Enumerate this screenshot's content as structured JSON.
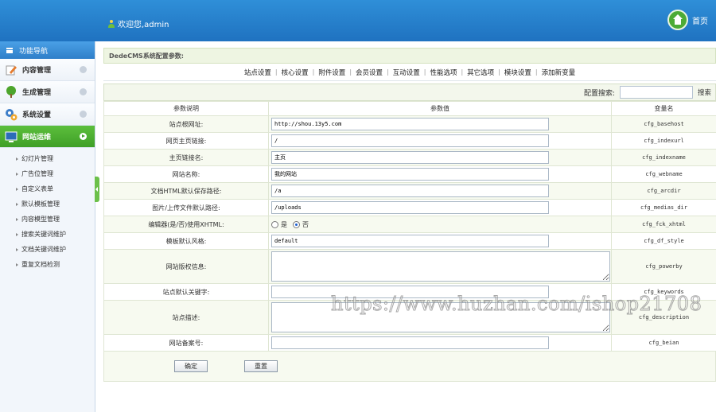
{
  "header": {
    "welcome": "欢迎您,admin",
    "home_label": "首页",
    "accent": "#2f8fd8"
  },
  "sidebar": {
    "title": "功能导航",
    "items": [
      {
        "label": "内容管理",
        "icon": "pencil-icon"
      },
      {
        "label": "生成管理",
        "icon": "tree-icon"
      },
      {
        "label": "系统设置",
        "icon": "gears-icon"
      },
      {
        "label": "网站运维",
        "icon": "monitor-icon",
        "active": true
      }
    ],
    "sub_items": [
      "幻灯片管理",
      "广告位管理",
      "自定义表单",
      "默认模板管理",
      "内容模型管理",
      "搜索关键词维护",
      "文档关键词维护",
      "重复文档检测"
    ]
  },
  "main": {
    "section_title": "DedeCMS系统配置参数:",
    "tabs": [
      "站点设置",
      "核心设置",
      "附件设置",
      "会员设置",
      "互动设置",
      "性能选项",
      "其它选项",
      "模块设置",
      "添加新变量"
    ],
    "search_label": "配置搜索:",
    "search_value": "",
    "search_button": "搜索",
    "table": {
      "headers": [
        "参数说明",
        "参数值",
        "变量名"
      ],
      "rows": [
        {
          "label": "站点根网址:",
          "type": "text",
          "value": "http://shou.13y5.com",
          "var": "cfg_basehost"
        },
        {
          "label": "网页主页链接:",
          "type": "text",
          "value": "/",
          "var": "cfg_indexurl"
        },
        {
          "label": "主页链接名:",
          "type": "text",
          "value": "主页",
          "var": "cfg_indexname"
        },
        {
          "label": "网站名称:",
          "type": "text",
          "value": "我的网站",
          "var": "cfg_webname"
        },
        {
          "label": "文档HTML默认保存路径:",
          "type": "text",
          "value": "/a",
          "var": "cfg_arcdir"
        },
        {
          "label": "图片/上传文件默认路径:",
          "type": "text",
          "value": "/uploads",
          "var": "cfg_medias_dir"
        },
        {
          "label": "编辑器(是/否)使用XHTML:",
          "type": "radio",
          "opt_yes": "是",
          "opt_no": "否",
          "var": "cfg_fck_xhtml"
        },
        {
          "label": "模板默认风格:",
          "type": "text",
          "value": "default",
          "var": "cfg_df_style"
        },
        {
          "label": "网站版权信息:",
          "type": "textarea",
          "value": "",
          "var": "cfg_powerby"
        },
        {
          "label": "站点默认关键字:",
          "type": "text",
          "value": "",
          "var": "cfg_keywords"
        },
        {
          "label": "站点描述:",
          "type": "textarea",
          "value": "",
          "var": "cfg_description"
        },
        {
          "label": "网站备案号:",
          "type": "text",
          "value": "",
          "var": "cfg_beian"
        }
      ]
    },
    "buttons": {
      "ok": "确定",
      "reset": "重置"
    }
  },
  "watermark": "https://www.huzhan.com/ishop21708"
}
